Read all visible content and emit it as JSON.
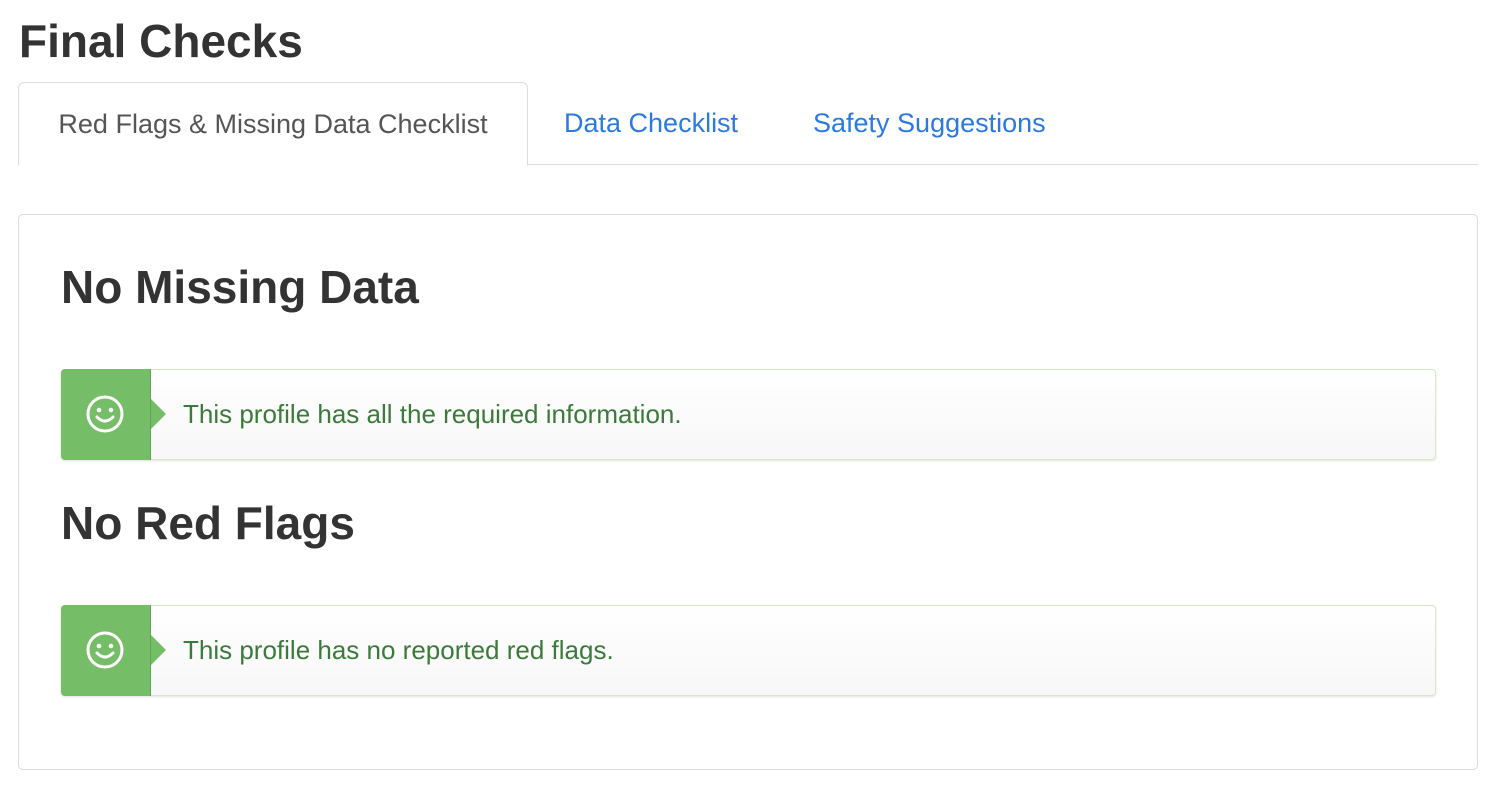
{
  "page": {
    "title": "Final Checks"
  },
  "tabs": [
    {
      "label": "Red Flags & Missing Data Checklist",
      "active": true
    },
    {
      "label": "Data Checklist",
      "active": false
    },
    {
      "label": "Safety Suggestions",
      "active": false
    }
  ],
  "sections": [
    {
      "heading": "No Missing Data",
      "alert": {
        "icon": "smile-icon",
        "text": "This profile has all the required information."
      }
    },
    {
      "heading": "No Red Flags",
      "alert": {
        "icon": "smile-icon",
        "text": "This profile has no reported red flags."
      }
    }
  ],
  "colors": {
    "link": "#2a7ae2",
    "success_icon_bg": "#76bd67",
    "success_text": "#3c7a3b",
    "alert_border": "#d6e9c6"
  }
}
